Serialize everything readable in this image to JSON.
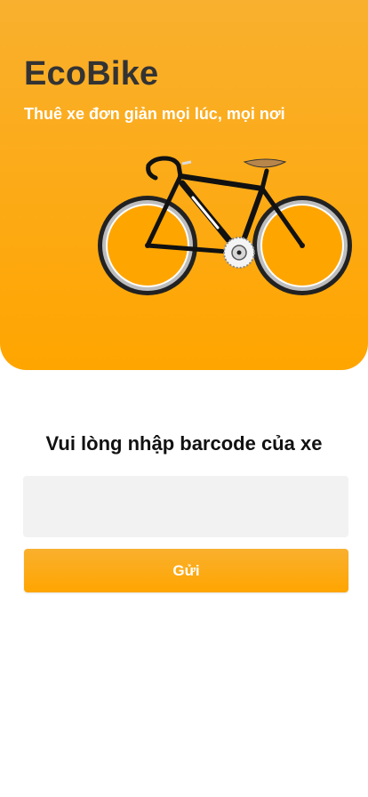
{
  "header": {
    "app_name": "EcoBike",
    "tagline": "Thuê xe đơn giản mọi lúc, mọi nơi",
    "illustration": "bicycle-illustration"
  },
  "form": {
    "prompt": "Vui lòng nhập barcode của xe",
    "barcode_value": "",
    "submit_label": "Gửi"
  },
  "colors": {
    "accent_top": "#F9B02E",
    "accent_bottom": "#FFA500",
    "title_text": "#333333",
    "input_bg": "#F2F2F2"
  }
}
